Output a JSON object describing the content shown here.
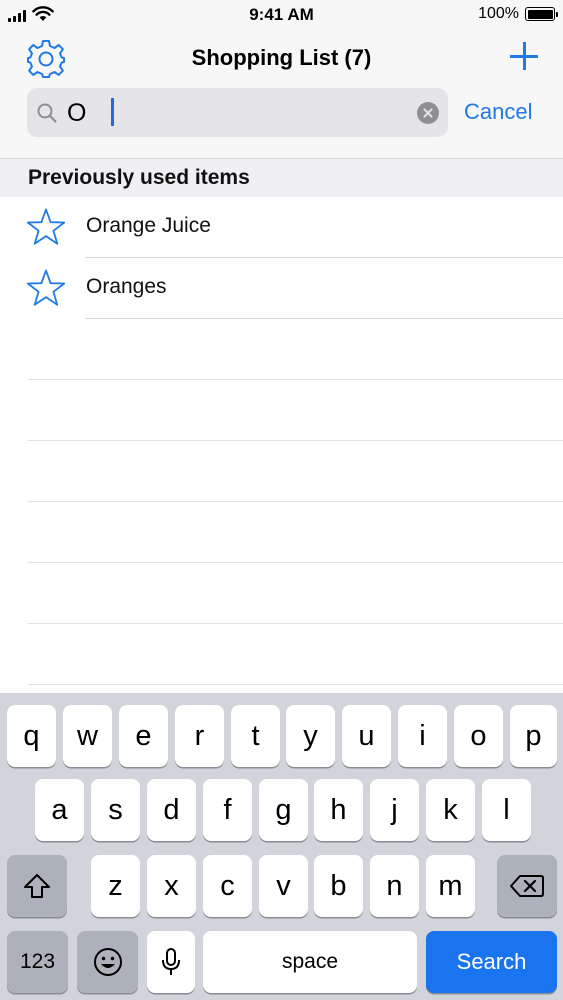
{
  "status_bar": {
    "time": "9:41 AM",
    "battery": "100%",
    "battery_level": 1.0
  },
  "header": {
    "title": "Shopping List (7)",
    "settings_icon": "gear-icon",
    "add_icon": "plus-icon"
  },
  "search": {
    "value": "O",
    "cancel_label": "Cancel",
    "search_icon": "magnifier-icon",
    "clear_icon": "clear-x-icon"
  },
  "section": {
    "title": "Previously used items"
  },
  "items": [
    {
      "label": "Orange Juice",
      "icon": "star-outline-icon"
    },
    {
      "label": "Oranges",
      "icon": "star-outline-icon"
    }
  ],
  "keyboard": {
    "row1": [
      "q",
      "w",
      "e",
      "r",
      "t",
      "y",
      "u",
      "i",
      "o",
      "p"
    ],
    "row2": [
      "a",
      "s",
      "d",
      "f",
      "g",
      "h",
      "j",
      "k",
      "l"
    ],
    "row3": [
      "z",
      "x",
      "c",
      "v",
      "b",
      "n",
      "m"
    ],
    "numbers_key": "123",
    "space_key": "space",
    "search_key": "Search",
    "shift_icon": "shift-icon",
    "backspace_icon": "backspace-icon",
    "emoji_icon": "emoji-icon",
    "mic_icon": "microphone-icon"
  },
  "colors": {
    "accent": "#1f7ae6",
    "search_key": "#1a74f0",
    "keyboard_bg": "#d1d4db",
    "dark_key": "#acb1bb"
  }
}
